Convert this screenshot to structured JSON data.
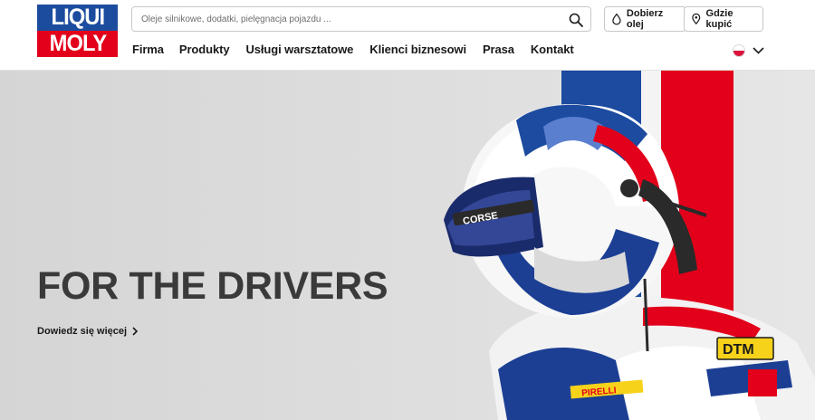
{
  "brand": {
    "line1": "LIQUI",
    "line2": "MOLY"
  },
  "search": {
    "placeholder": "Oleje silnikowe, dodatki, pielęgnacja pojazdu ..."
  },
  "actions": {
    "oil_finder": "Dobierz olej",
    "where_to_buy": "Gdzie kupić"
  },
  "nav": {
    "items": [
      {
        "label": "Firma"
      },
      {
        "label": "Produkty"
      },
      {
        "label": "Usługi warsztatowe"
      },
      {
        "label": "Klienci biznesowi"
      },
      {
        "label": "Prasa"
      },
      {
        "label": "Kontakt"
      }
    ]
  },
  "language": {
    "flag": "poland-flag-icon"
  },
  "hero": {
    "title": "FOR THE DRIVERS",
    "cta": "Dowiedz się więcej",
    "image_text": {
      "brand": "CORSE",
      "sponsor1": "DTM",
      "sponsor2": "PIRELLI"
    }
  },
  "colors": {
    "brand_blue": "#1c4c9e",
    "brand_red": "#e2001a",
    "text": "#1a1a1a",
    "hero_title": "#3a3a3a"
  }
}
